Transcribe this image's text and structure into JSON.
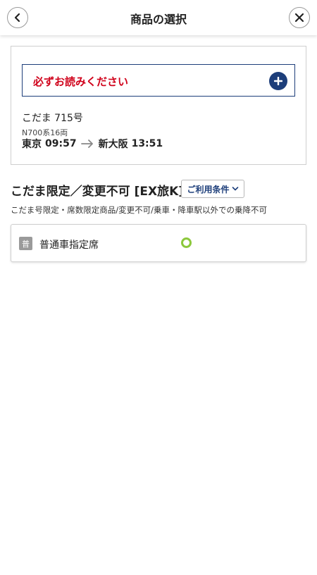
{
  "header": {
    "title": "商品の選択",
    "back_icon": "chevron-left-icon",
    "close_icon": "close-icon"
  },
  "notice": {
    "label": "必ずお読みください",
    "icon": "plus-icon",
    "label_color": "#d0021b",
    "accent_color": "#1d3e7a"
  },
  "train": {
    "name": "こだま 715号",
    "type": "N700系16両",
    "departure_station": "東京",
    "departure_time": "09:57",
    "arrival_station": "新大阪",
    "arrival_time": "13:51"
  },
  "plan": {
    "title": "こだま限定／変更不可 [EX旅K]",
    "conditions_label": "ご利用条件",
    "description": "こだま号限定・席数限定商品/変更不可/乗車・降車駅以外での乗降不可"
  },
  "seat": {
    "badge": "普",
    "label": "普通車指定席",
    "availability": "available",
    "availability_icon": "circle-available-icon",
    "availability_color": "#8cc83c"
  }
}
